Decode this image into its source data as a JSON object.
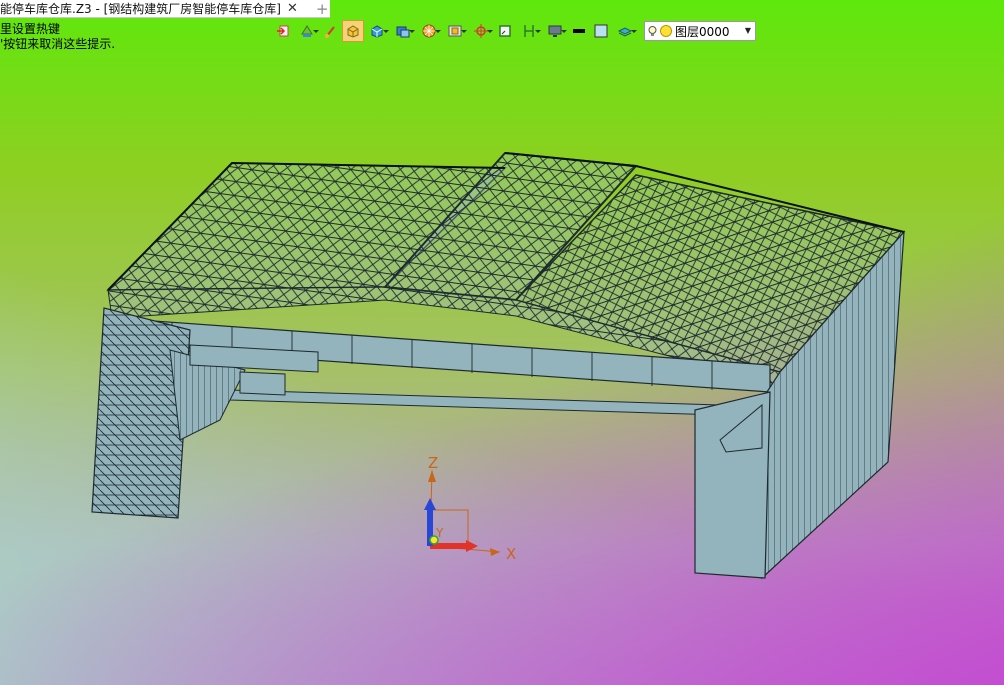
{
  "tab": {
    "title": "能停车库仓库.Z3 - [钢结构建筑厂房智能停车库仓库]",
    "close_glyph": "✕",
    "new_glyph": "+"
  },
  "hint": {
    "line1": "里设置热键",
    "line2": "'按钮来取消这些提示."
  },
  "toolbar": {
    "items": [
      {
        "icon": "import-icon"
      },
      {
        "icon": "display-mode-icon"
      },
      {
        "icon": "brush-icon"
      },
      {
        "icon": "shaded-view-icon"
      },
      {
        "icon": "cube-view-icon"
      },
      {
        "icon": "standard-views-icon"
      },
      {
        "icon": "render-options-icon"
      },
      {
        "icon": "zoom-window-icon"
      },
      {
        "icon": "snap-icon"
      },
      {
        "icon": "sketch-plane-icon"
      },
      {
        "icon": "dimension-icon"
      },
      {
        "icon": "monitor-icon"
      },
      {
        "icon": "line-weight-icon"
      },
      {
        "icon": "color-icon"
      },
      {
        "icon": "layer-icon"
      }
    ],
    "layer_value": "图层0000"
  },
  "axes": {
    "x": "X",
    "y": "Y",
    "z": "Z"
  },
  "colors": {
    "structure_fill": "#93b3bd",
    "structure_stroke": "#1d2a2e",
    "axis_x": "#e2332b",
    "axis_z": "#2a46d6",
    "axis_y": "#2ea82e",
    "axis_label": "#c8661c"
  }
}
